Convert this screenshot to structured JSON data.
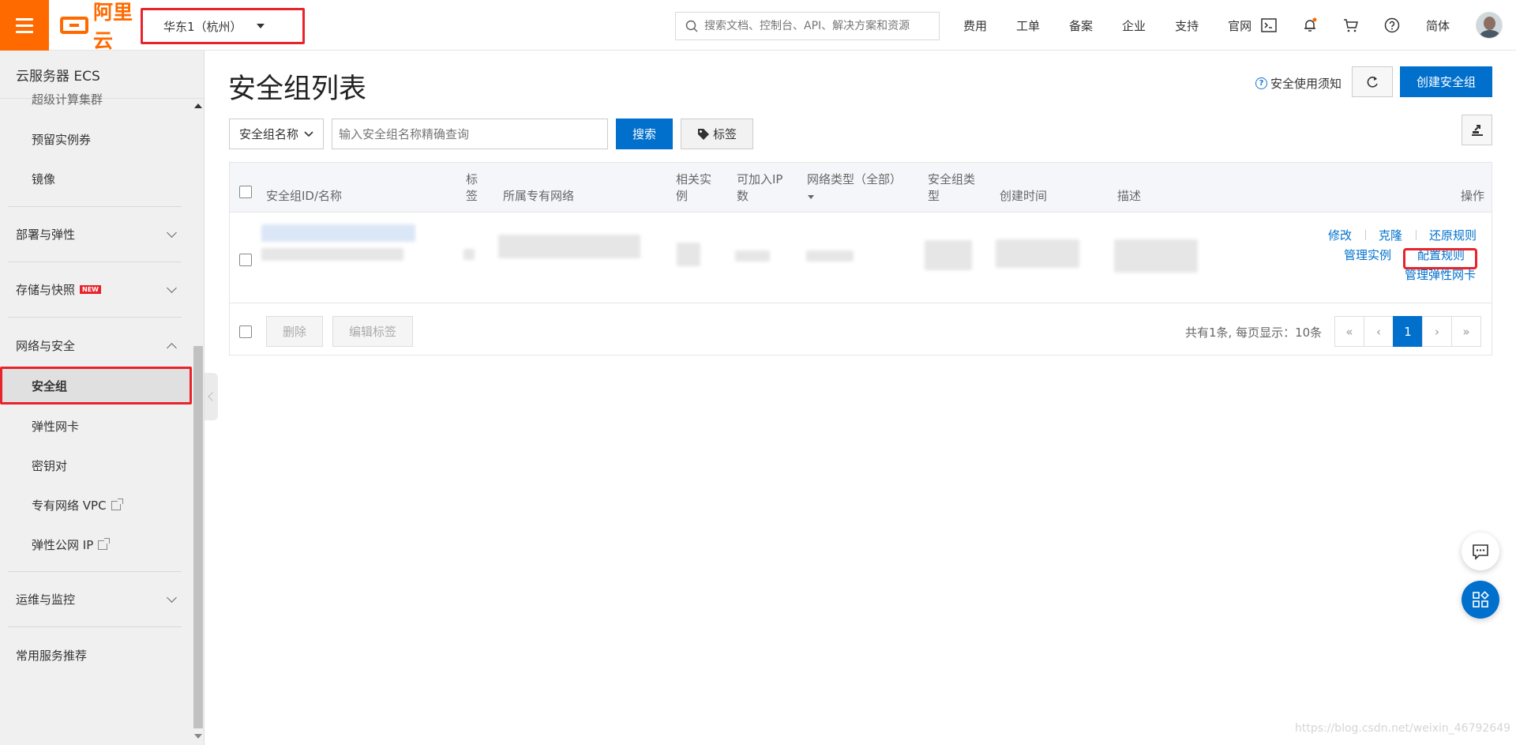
{
  "brand": {
    "logo_text": "阿里云",
    "accent": "#ff6a00",
    "primary": "#0070cc",
    "highlight": "#e8232a"
  },
  "topbar": {
    "region": "华东1（杭州）",
    "search_placeholder": "搜索文档、控制台、API、解决方案和资源",
    "nav": [
      "费用",
      "工单",
      "备案",
      "企业",
      "支持",
      "官网"
    ],
    "icons": [
      "terminal-icon",
      "bell-icon",
      "cart-icon",
      "help-icon"
    ],
    "language": "简体"
  },
  "sidebar": {
    "title": "云服务器 ECS",
    "items_top": [
      "超级计算集群",
      "预留实例券",
      "镜像"
    ],
    "groups": [
      {
        "label": "部署与弹性",
        "expanded": false
      },
      {
        "label": "存储与快照",
        "badge": "NEW",
        "expanded": false
      },
      {
        "label": "网络与安全",
        "expanded": true
      },
      {
        "label": "运维与监控",
        "expanded": false
      },
      {
        "label": "常用服务推荐"
      }
    ],
    "network_items": [
      "安全组",
      "弹性网卡",
      "密钥对",
      "专有网络 VPC",
      "弹性公网 IP"
    ],
    "active": "安全组"
  },
  "main": {
    "title": "安全组列表",
    "safety_notice": "安全使用须知",
    "create_button": "创建安全组",
    "filter_select": "安全组名称",
    "filter_placeholder": "输入安全组名称精确查询",
    "search_button": "搜索",
    "tag_button": "标签",
    "columns": {
      "id_name": "安全组ID/名称",
      "tag_line1": "标",
      "tag_line2": "签",
      "vpc": "所属专有网络",
      "rel_line1": "相关实",
      "rel_line2": "例",
      "ip_line1": "可加入IP",
      "ip_line2": "数",
      "net_type": "网络类型（全部）",
      "sg_line1": "安全组类",
      "sg_line2": "型",
      "created": "创建时间",
      "desc": "描述",
      "ops": "操作"
    },
    "row_actions": {
      "modify": "修改",
      "clone": "克隆",
      "restore": "还原规则",
      "manage_instances": "管理实例",
      "configure_rules": "配置规则",
      "manage_eni": "管理弹性网卡"
    },
    "footer": {
      "delete": "删除",
      "edit_tags": "编辑标签",
      "summary": "共有1条, 每页显示：10条",
      "pages": [
        "«",
        "‹",
        "1",
        "›",
        "»"
      ],
      "current_page": "1"
    }
  },
  "watermark": "https://blog.csdn.net/weixin_46792649"
}
